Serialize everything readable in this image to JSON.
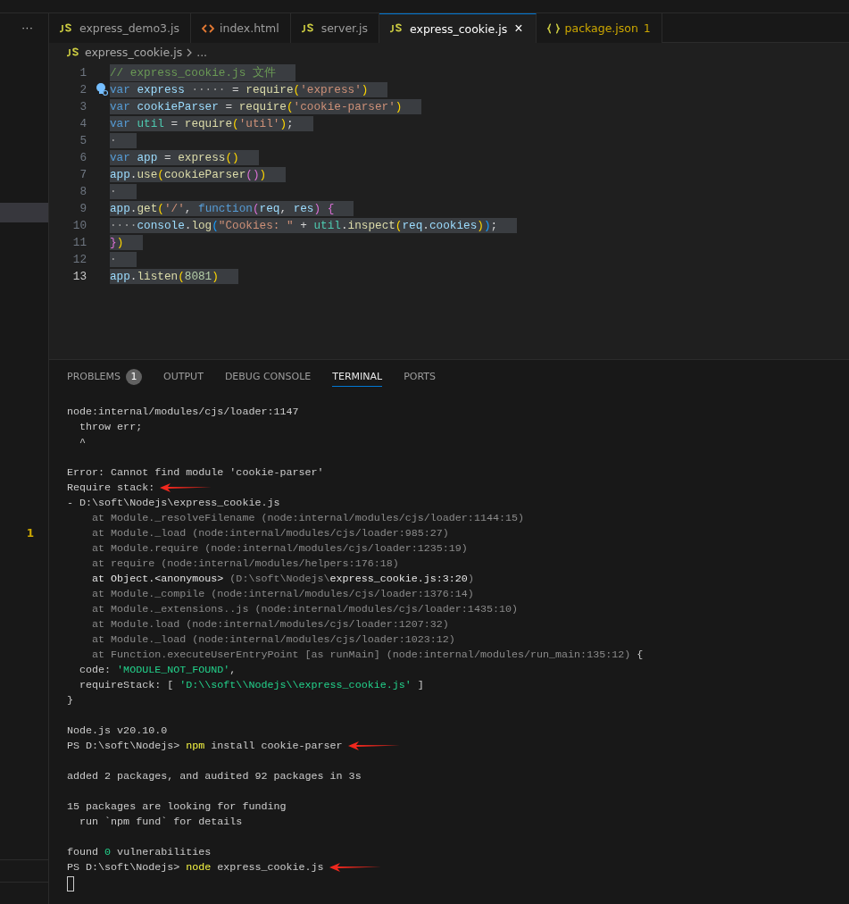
{
  "sidebar": {
    "problem_count": "1"
  },
  "tabs": [
    {
      "label": "express_demo3.js",
      "kind": "js",
      "selected": false,
      "warning": false
    },
    {
      "label": "index.html",
      "kind": "html",
      "selected": false,
      "warning": false
    },
    {
      "label": "server.js",
      "kind": "js",
      "selected": false,
      "warning": false
    },
    {
      "label": "express_cookie.js",
      "kind": "js",
      "selected": true,
      "warning": false,
      "close": "×"
    },
    {
      "label": "package.json",
      "kind": "json",
      "selected": false,
      "warning": true,
      "badge": "1"
    }
  ],
  "more_actions": "···",
  "breadcrumb": {
    "file": "express_cookie.js",
    "rest": "..."
  },
  "editor": {
    "selection": true,
    "lines": [
      {
        "number": "1",
        "tokens": [
          {
            "text": "// express_cookie.js 文件",
            "kind": "comment"
          }
        ]
      },
      {
        "number": "2",
        "lightbulb": true,
        "tokens": [
          {
            "text": "var ",
            "kind": "keyword"
          },
          {
            "text": "express",
            "kind": "variable"
          },
          {
            "text": " ····· ",
            "kind": "ws"
          },
          {
            "text": "= ",
            "kind": "plain"
          },
          {
            "text": "require",
            "kind": "function"
          },
          {
            "text": "(",
            "kind": "bracket1"
          },
          {
            "text": "'express'",
            "kind": "string"
          },
          {
            "text": ")",
            "kind": "bracket1"
          }
        ]
      },
      {
        "number": "3",
        "tokens": [
          {
            "text": "var ",
            "kind": "keyword"
          },
          {
            "text": "cookieParser",
            "kind": "variable"
          },
          {
            "text": " = ",
            "kind": "plain"
          },
          {
            "text": "require",
            "kind": "function"
          },
          {
            "text": "(",
            "kind": "bracket1"
          },
          {
            "text": "'cookie-parser'",
            "kind": "string"
          },
          {
            "text": ")",
            "kind": "bracket1"
          }
        ]
      },
      {
        "number": "4",
        "tokens": [
          {
            "text": "var ",
            "kind": "keyword"
          },
          {
            "text": "util",
            "kind": "module"
          },
          {
            "text": " = ",
            "kind": "plain"
          },
          {
            "text": "require",
            "kind": "function"
          },
          {
            "text": "(",
            "kind": "bracket1"
          },
          {
            "text": "'util'",
            "kind": "string"
          },
          {
            "text": ")",
            "kind": "bracket1"
          },
          {
            "text": ";",
            "kind": "plain"
          }
        ]
      },
      {
        "number": "5",
        "tokens": [
          {
            "text": "·",
            "kind": "ws"
          }
        ]
      },
      {
        "number": "6",
        "tokens": [
          {
            "text": "var ",
            "kind": "keyword"
          },
          {
            "text": "app",
            "kind": "variable"
          },
          {
            "text": " = ",
            "kind": "plain"
          },
          {
            "text": "express",
            "kind": "function"
          },
          {
            "text": "()",
            "kind": "bracket1"
          }
        ]
      },
      {
        "number": "7",
        "tokens": [
          {
            "text": "app",
            "kind": "variable"
          },
          {
            "text": ".",
            "kind": "plain"
          },
          {
            "text": "use",
            "kind": "function"
          },
          {
            "text": "(",
            "kind": "bracket1"
          },
          {
            "text": "cookieParser",
            "kind": "function"
          },
          {
            "text": "()",
            "kind": "bracket2"
          },
          {
            "text": ")",
            "kind": "bracket1"
          }
        ]
      },
      {
        "number": "8",
        "tokens": [
          {
            "text": "·",
            "kind": "ws"
          }
        ]
      },
      {
        "number": "9",
        "tokens": [
          {
            "text": "app",
            "kind": "variable"
          },
          {
            "text": ".",
            "kind": "plain"
          },
          {
            "text": "get",
            "kind": "function"
          },
          {
            "text": "(",
            "kind": "bracket1"
          },
          {
            "text": "'/'",
            "kind": "string"
          },
          {
            "text": ", ",
            "kind": "plain"
          },
          {
            "text": "function",
            "kind": "keyword"
          },
          {
            "text": "(",
            "kind": "bracket2"
          },
          {
            "text": "req",
            "kind": "variable"
          },
          {
            "text": ", ",
            "kind": "plain"
          },
          {
            "text": "res",
            "kind": "variable"
          },
          {
            "text": ")",
            "kind": "bracket2"
          },
          {
            "text": " {",
            "kind": "bracket2"
          }
        ]
      },
      {
        "number": "10",
        "tokens": [
          {
            "text": "····",
            "kind": "ws"
          },
          {
            "text": "console",
            "kind": "variable"
          },
          {
            "text": ".",
            "kind": "plain"
          },
          {
            "text": "log",
            "kind": "function"
          },
          {
            "text": "(",
            "kind": "bracket3"
          },
          {
            "text": "\"Cookies: \"",
            "kind": "string"
          },
          {
            "text": " + ",
            "kind": "plain"
          },
          {
            "text": "util",
            "kind": "module"
          },
          {
            "text": ".",
            "kind": "plain"
          },
          {
            "text": "inspect",
            "kind": "function"
          },
          {
            "text": "(",
            "kind": "bracket1"
          },
          {
            "text": "req",
            "kind": "variable"
          },
          {
            "text": ".",
            "kind": "plain"
          },
          {
            "text": "cookies",
            "kind": "variable"
          },
          {
            "text": ")",
            "kind": "bracket1"
          },
          {
            "text": ")",
            "kind": "bracket3"
          },
          {
            "text": ";",
            "kind": "plain"
          }
        ]
      },
      {
        "number": "11",
        "tokens": [
          {
            "text": "}",
            "kind": "bracket2"
          },
          {
            "text": ")",
            "kind": "bracket1"
          }
        ]
      },
      {
        "number": "12",
        "tokens": [
          {
            "text": "·",
            "kind": "ws"
          }
        ]
      },
      {
        "number": "13",
        "current": true,
        "tokens": [
          {
            "text": "app",
            "kind": "variable"
          },
          {
            "text": ".",
            "kind": "plain"
          },
          {
            "text": "listen",
            "kind": "function"
          },
          {
            "text": "(",
            "kind": "bracket1"
          },
          {
            "text": "8081",
            "kind": "number"
          },
          {
            "text": ")",
            "kind": "bracket1"
          }
        ]
      }
    ]
  },
  "panel_tabs": [
    {
      "label": "PROBLEMS",
      "badge": "1",
      "selected": false
    },
    {
      "label": "OUTPUT",
      "selected": false
    },
    {
      "label": "DEBUG CONSOLE",
      "selected": false
    },
    {
      "label": "TERMINAL",
      "selected": true
    },
    {
      "label": "PORTS",
      "selected": false
    }
  ],
  "terminal": {
    "lines": [
      {
        "segments": [
          {
            "text": "node:internal/modules/cjs/loader:1147",
            "kind": "plain"
          }
        ]
      },
      {
        "segments": [
          {
            "text": "  throw err;",
            "kind": "plain"
          }
        ]
      },
      {
        "segments": [
          {
            "text": "  ^",
            "kind": "plain"
          }
        ]
      },
      {
        "space_before": true,
        "segments": [
          {
            "text": "Error: Cannot find module 'cookie-parser'",
            "kind": "plain"
          }
        ]
      },
      {
        "arrow": true,
        "segments": [
          {
            "text": "Require stack:",
            "kind": "plain"
          }
        ]
      },
      {
        "segments": [
          {
            "text": "- D:\\soft\\Nodejs\\express_cookie.js",
            "kind": "plain"
          }
        ]
      },
      {
        "segments": [
          {
            "text": "    at Module._resolveFilename (node:internal/modules/cjs/loader:1144:15)",
            "kind": "dim"
          }
        ]
      },
      {
        "segments": [
          {
            "text": "    at Module._load (node:internal/modules/cjs/loader:985:27)",
            "kind": "dim"
          }
        ]
      },
      {
        "segments": [
          {
            "text": "    at Module.require (node:internal/modules/cjs/loader:1235:19)",
            "kind": "dim"
          }
        ]
      },
      {
        "segments": [
          {
            "text": "    at require (node:internal/modules/helpers:176:18)",
            "kind": "dim"
          }
        ]
      },
      {
        "segments": [
          {
            "text": "    at Object.<anonymous>",
            "kind": "bright"
          },
          {
            "text": " (D:\\soft\\Nodejs\\",
            "kind": "dim"
          },
          {
            "text": "express_cookie.js:3:20",
            "kind": "bright"
          },
          {
            "text": ")",
            "kind": "dim"
          }
        ]
      },
      {
        "segments": [
          {
            "text": "    at Module._compile (node:internal/modules/cjs/loader:1376:14)",
            "kind": "dim"
          }
        ]
      },
      {
        "segments": [
          {
            "text": "    at Module._extensions..js (node:internal/modules/cjs/loader:1435:10)",
            "kind": "dim"
          }
        ]
      },
      {
        "segments": [
          {
            "text": "    at Module.load (node:internal/modules/cjs/loader:1207:32)",
            "kind": "dim"
          }
        ]
      },
      {
        "segments": [
          {
            "text": "    at Module._load (node:internal/modules/cjs/loader:1023:12)",
            "kind": "dim"
          }
        ]
      },
      {
        "segments": [
          {
            "text": "    at Function.executeUserEntryPoint [as runMain] (node:internal/modules/run_main:135:12)",
            "kind": "dim"
          },
          {
            "text": " {",
            "kind": "plain"
          }
        ]
      },
      {
        "segments": [
          {
            "text": "  code: ",
            "kind": "plain"
          },
          {
            "text": "'MODULE_NOT_FOUND'",
            "kind": "green"
          },
          {
            "text": ",",
            "kind": "plain"
          }
        ]
      },
      {
        "segments": [
          {
            "text": "  requireStack: [ ",
            "kind": "plain"
          },
          {
            "text": "'D:\\\\soft\\\\Nodejs\\\\express_cookie.js'",
            "kind": "green"
          },
          {
            "text": " ]",
            "kind": "plain"
          }
        ]
      },
      {
        "segments": [
          {
            "text": "}",
            "kind": "plain"
          }
        ]
      },
      {
        "space_before": true,
        "segments": [
          {
            "text": "Node.js v20.10.0",
            "kind": "plain"
          }
        ]
      },
      {
        "arrow": true,
        "segments": [
          {
            "text": "PS D:\\soft\\Nodejs> ",
            "kind": "plain"
          },
          {
            "text": "npm",
            "kind": "yellow"
          },
          {
            "text": " install cookie-parser",
            "kind": "plain"
          }
        ]
      },
      {
        "space_before": true,
        "segments": [
          {
            "text": "added 2 packages, and audited 92 packages in 3s",
            "kind": "plain"
          }
        ]
      },
      {
        "space_before": true,
        "segments": [
          {
            "text": "15 packages are looking for funding",
            "kind": "plain"
          }
        ]
      },
      {
        "segments": [
          {
            "text": "  run `npm fund` for details",
            "kind": "plain"
          }
        ]
      },
      {
        "space_before": true,
        "segments": [
          {
            "text": "found ",
            "kind": "plain"
          },
          {
            "text": "0",
            "kind": "green"
          },
          {
            "text": " vulnerabilities",
            "kind": "plain"
          }
        ]
      },
      {
        "arrow": true,
        "segments": [
          {
            "text": "PS D:\\soft\\Nodejs> ",
            "kind": "plain"
          },
          {
            "text": "node",
            "kind": "yellow"
          },
          {
            "text": " express_cookie.js",
            "kind": "plain"
          }
        ]
      }
    ],
    "cursor": true
  }
}
